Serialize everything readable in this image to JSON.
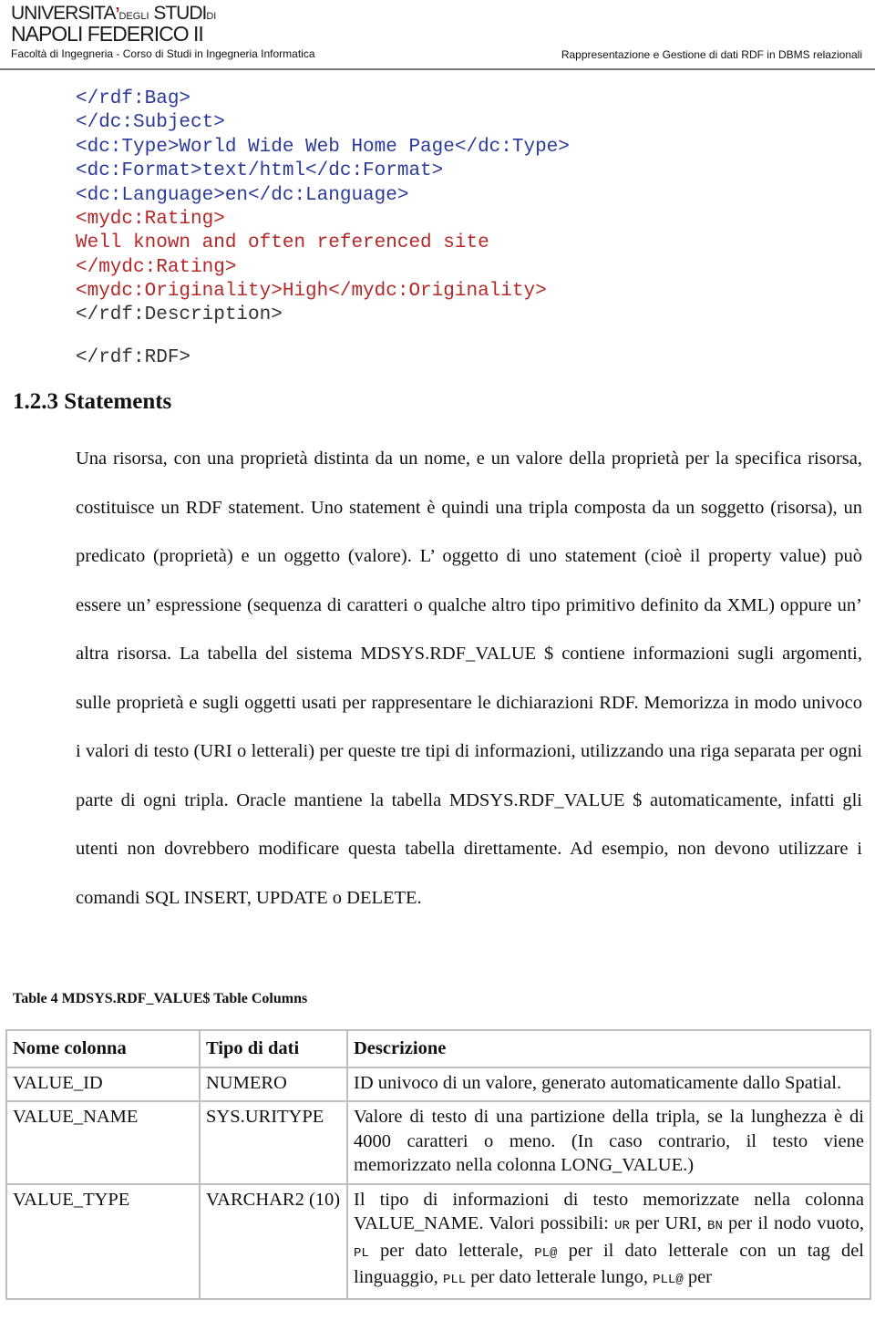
{
  "header": {
    "logo_line1_a": "UNIVERSITA",
    "logo_line1_b": "DEGLI",
    "logo_line1_c": "STUDI",
    "logo_line1_d": "DI",
    "logo_line2": "NAPOLI FEDERICO II",
    "faculty": "Facoltà di Ingegneria - Corso di Studi in Ingegneria Informatica",
    "document_title": "Rappresentazione e Gestione di dati RDF in DBMS relazionali"
  },
  "code_lines": [
    {
      "text": "</rdf:Bag>",
      "color": "blue"
    },
    {
      "text": "</dc:Subject>",
      "color": "blue"
    },
    {
      "text": "<dc:Type>World Wide Web Home Page</dc:Type>",
      "color": "blue"
    },
    {
      "text": "<dc:Format>text/html</dc:Format>",
      "color": "blue"
    },
    {
      "text": "<dc:Language>en</dc:Language>",
      "color": "blue"
    },
    {
      "text": "<mydc:Rating>",
      "color": "red"
    },
    {
      "text": "Well known and often referenced site",
      "color": "red"
    },
    {
      "text": "</mydc:Rating>",
      "color": "red"
    },
    {
      "text": "<mydc:Originality>High</mydc:Originality>",
      "color": "red"
    },
    {
      "text": "</rdf:Description>",
      "color": "gray"
    },
    {
      "text": "</rdf:RDF>",
      "color": "gray"
    }
  ],
  "section": {
    "heading": "1.2.3 Statements",
    "paragraph": "Una risorsa, con una proprietà distinta da un nome, e un valore della proprietà per la specifica risorsa, costituisce un RDF statement. Uno statement è quindi una tripla composta da un soggetto (risorsa), un predicato (proprietà) e un oggetto (valore). L’ oggetto di uno statement (cioè il property value) può essere un’ espressione (sequenza di caratteri o qualche altro tipo primitivo definito da XML) oppure un’ altra risorsa. La tabella del sistema MDSYS.RDF_VALUE $  contiene informazioni sugli argomenti, sulle proprietà e sugli oggetti usati per rappresentare le dichiarazioni RDF. Memorizza in modo univoco i valori di testo (URI o letterali) per queste tre tipi di informazioni, utilizzando una riga separata per ogni parte di ogni tripla. Oracle mantiene la tabella MDSYS.RDF_VALUE $ automaticamente, infatti gli utenti non dovrebbero modificare questa tabella direttamente. Ad esempio, non devono utilizzare i comandi SQL INSERT, UPDATE o DELETE."
  },
  "table": {
    "caption": "Table 4 MDSYS.RDF_VALUE$ Table Columns",
    "headers": [
      "Nome colonna",
      "Tipo di dati",
      "Descrizione"
    ],
    "rows": [
      {
        "name": "VALUE_ID",
        "type": "NUMERO",
        "desc": "ID univoco di un valore, generato automaticamente dallo Spatial."
      },
      {
        "name": "VALUE_NAME",
        "type": "SYS.URITYPE",
        "desc": "Valore di testo di una partizione della tripla, se la lunghezza è di 4000 caratteri o meno. (In caso contrario, il testo viene memorizzato nella colonna LONG_VALUE.)"
      },
      {
        "name": "VALUE_TYPE",
        "type": "VARCHAR2 (10)",
        "desc_parts": [
          {
            "t": "Il tipo di informazioni di testo memorizzate nella colonna VALUE_NAME. Valori possibili: "
          },
          {
            "code": "UR"
          },
          {
            "t": " per URI, "
          },
          {
            "code": "BN"
          },
          {
            "t": " per il nodo vuoto, "
          },
          {
            "code": "PL"
          },
          {
            "t": " per dato letterale, "
          },
          {
            "code": "PL@"
          },
          {
            "t": " per il dato letterale con un tag del linguaggio, "
          },
          {
            "code": "PLL"
          },
          {
            "t": " per dato letterale lungo, "
          },
          {
            "code": "PLL@"
          },
          {
            "t": " per"
          }
        ]
      }
    ]
  }
}
